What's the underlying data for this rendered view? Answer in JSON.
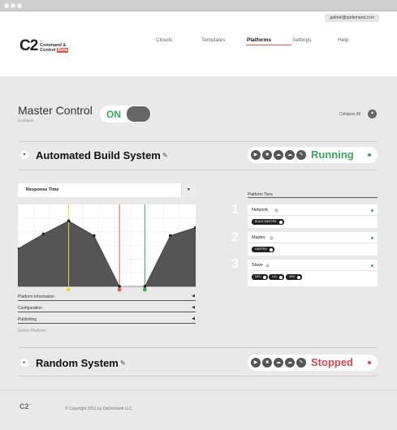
{
  "header": {
    "user_email": "gabriel@opdemand.com",
    "logo": {
      "mark": "C2",
      "tm": "™",
      "line1": "Command &",
      "line2": "Control",
      "beta": "Beta"
    },
    "nav": [
      {
        "label": "Clouds",
        "active": false
      },
      {
        "label": "Templates",
        "active": false
      },
      {
        "label": "Platforms",
        "active": true
      },
      {
        "label": "Settings",
        "active": false
      },
      {
        "label": "Help",
        "active": false
      }
    ],
    "accent_color": "#e0584a"
  },
  "master": {
    "title": "Master Control",
    "subtitle": "Configure",
    "toggle_label": "ON",
    "collapse_label": "Collapse All",
    "collapse_icon": "chevron-down-icon"
  },
  "systems": [
    {
      "name": "Automated Build System",
      "status": "Running",
      "status_color": "#3aa85f",
      "expanded": true,
      "controls": [
        "play-icon",
        "stop-icon",
        "cloud-icon",
        "cloud-alt-icon",
        "edit-icon"
      ]
    },
    {
      "name": "Random System",
      "status": "Stopped",
      "status_color": "#d9474f",
      "expanded": false,
      "controls": [
        "play-icon",
        "stop-icon",
        "cloud-icon",
        "cloud-alt-icon",
        "edit-icon"
      ]
    }
  ],
  "metric_select": {
    "value": "Response Time"
  },
  "chart_data": {
    "type": "area",
    "x": [
      0,
      1,
      2,
      3,
      4,
      5,
      6,
      7
    ],
    "values": [
      46,
      64,
      80,
      62,
      0,
      0,
      62,
      72
    ],
    "ylim": [
      0,
      100
    ],
    "grid": true,
    "area_color": "#555555",
    "markers": [
      {
        "x": 2,
        "color": "#e8e02a",
        "icon": "info-icon"
      },
      {
        "x": 4,
        "color": "#e0584a",
        "icon": "stop-icon"
      },
      {
        "x": 5,
        "color": "#3aa85f",
        "icon": "play-icon"
      }
    ]
  },
  "sections": [
    {
      "label": "Platform Information"
    },
    {
      "label": "Configuration"
    },
    {
      "label": "Publishing"
    }
  ],
  "delete_label": "Delete Platform",
  "tiers": {
    "title": "Platform Tiers",
    "items": [
      {
        "number": "1",
        "name": "Network",
        "tags": [
          "BUILD MASTER"
        ]
      },
      {
        "number": "2",
        "name": "Master",
        "tags": [
          "HASTEN"
        ]
      },
      {
        "number": "3",
        "name": "Slave",
        "tags": [
          "DEV",
          "LIN",
          "WIN"
        ]
      }
    ]
  },
  "footer": {
    "logo": "C2",
    "tm": "™",
    "copyright": "© Copyright 2011 by OpDemand LLC"
  }
}
